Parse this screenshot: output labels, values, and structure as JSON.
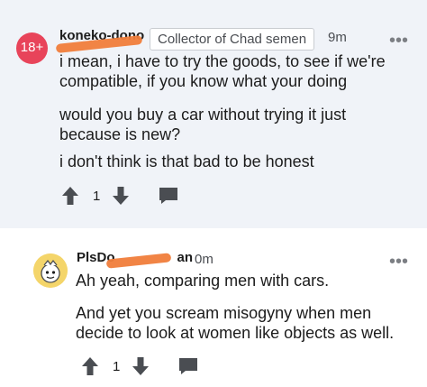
{
  "comments": [
    {
      "avatar_label": "18+",
      "username": "koneko-dono",
      "flair": "Collector of Chad semen",
      "time": "9m",
      "more": "•••",
      "paragraphs": [
        "i mean, i have to try the goods, to see if we're compatible, if you know what your doing",
        "would you buy a car without trying it just because is new?",
        "i don't think is that bad to be honest"
      ],
      "score": "1"
    },
    {
      "username_start": "PlsDo",
      "username_end": "an",
      "time": "0m",
      "more": "•••",
      "paragraphs": [
        "Ah yeah, comparing men with cars.",
        "And yet you scream misogyny when men decide to look at women like objects as well."
      ],
      "score": "1"
    }
  ],
  "colors": {
    "thread_highlight": "#f0f3f8",
    "nsfw": "#e8445a",
    "redaction": "#f07d3b"
  }
}
